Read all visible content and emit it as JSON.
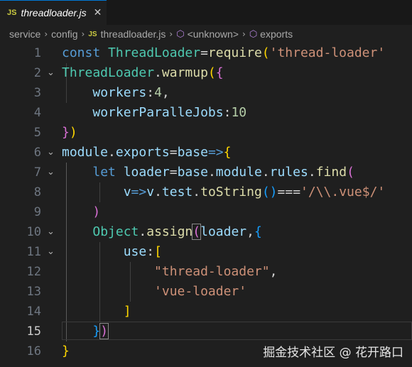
{
  "tab": {
    "badge": "JS",
    "title": "threadloader.js",
    "close": "✕"
  },
  "breadcrumb": {
    "items": [
      "service",
      "config",
      "threadloader.js",
      "<unknown>",
      "exports"
    ],
    "file_badge": "JS",
    "symbol_icon": "cube-icon"
  },
  "editor": {
    "active_line": 15,
    "line_numbers": [
      "1",
      "2",
      "3",
      "4",
      "5",
      "6",
      "7",
      "8",
      "9",
      "10",
      "11",
      "12",
      "13",
      "14",
      "15",
      "16"
    ]
  },
  "code_text": {
    "l1": [
      "const",
      " ",
      "ThreadLoader",
      "=",
      "require",
      "(",
      "'thread-loader'"
    ],
    "l2": [
      "ThreadLoader",
      ".",
      "warmup",
      "(",
      "{"
    ],
    "l3": [
      "workers",
      ":",
      "4",
      ","
    ],
    "l4": [
      "workerParalleJobs",
      ":",
      "10"
    ],
    "l5": [
      "}",
      ")"
    ],
    "l6": [
      "module",
      ".",
      "exports",
      "=",
      "base",
      "=>",
      "{"
    ],
    "l7": [
      "let",
      " ",
      "loader",
      "=",
      "base",
      ".",
      "module",
      ".",
      "rules",
      ".",
      "find",
      "("
    ],
    "l8": [
      "v",
      "=>",
      "v",
      ".",
      "test",
      ".",
      "toString",
      "(",
      ")",
      "===",
      "'/\\\\.vue$/'"
    ],
    "l9": [
      ")"
    ],
    "l10": [
      "Object",
      ".",
      "assign",
      "(",
      "loader",
      ",",
      "{"
    ],
    "l11": [
      "use",
      ":",
      "["
    ],
    "l12": [
      "\"thread-loader\"",
      ","
    ],
    "l13": [
      "'vue-loader'"
    ],
    "l14": [
      "]"
    ],
    "l15": [
      "}",
      ")"
    ],
    "l16": [
      "}"
    ]
  },
  "watermark": "掘金技术社区 @ 花开路口"
}
